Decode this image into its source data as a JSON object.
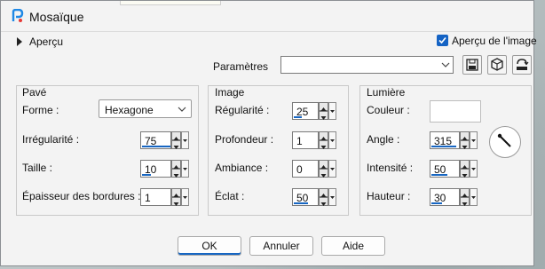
{
  "window": {
    "title": "Mosaïque"
  },
  "preview": {
    "label": "Aperçu",
    "checkbox_label": "Aperçu de l'image",
    "checked": true
  },
  "params": {
    "label": "Paramètres",
    "value": ""
  },
  "pave": {
    "title": "Pavé",
    "forme_label": "Forme :",
    "forme_value": "Hexagone",
    "irregularite_label": "Irrégularité :",
    "irregularite_value": "75",
    "taille_label": "Taille :",
    "taille_value": "10",
    "epaisseur_label": "Épaisseur des bordures :",
    "epaisseur_value": "1"
  },
  "image": {
    "title": "Image",
    "regularite_label": "Régularité :",
    "regularite_value": "25",
    "profondeur_label": "Profondeur :",
    "profondeur_value": "1",
    "ambiance_label": "Ambiance :",
    "ambiance_value": "0",
    "eclat_label": "Éclat :",
    "eclat_value": "50"
  },
  "lumiere": {
    "title": "Lumière",
    "couleur_label": "Couleur :",
    "couleur_value": "#ffffff",
    "angle_label": "Angle :",
    "angle_value": "315",
    "intensite_label": "Intensité :",
    "intensite_value": "50",
    "hauteur_label": "Hauteur :",
    "hauteur_value": "30"
  },
  "buttons": {
    "ok": "OK",
    "cancel": "Annuler",
    "help": "Aide"
  },
  "colors": {
    "accent": "#1766c2",
    "dialog_bg": "#f3f3f3"
  }
}
